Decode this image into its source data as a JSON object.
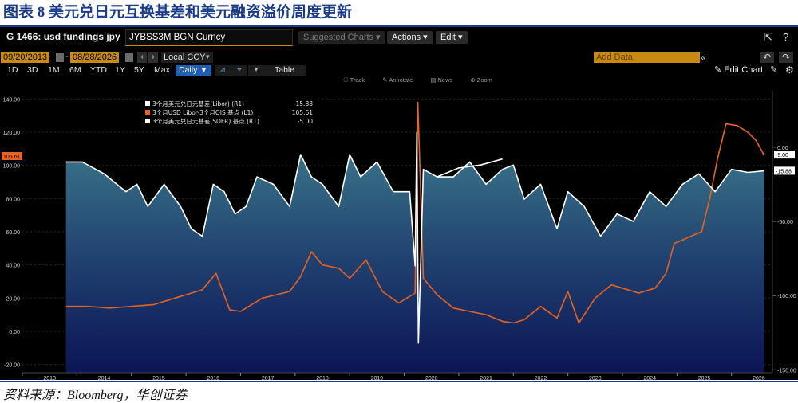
{
  "figure": {
    "title": "图表 8 美元兑日元互换基差和美元融资溢价周度更新",
    "source": "资料来源：Bloomberg，华创证券"
  },
  "header": {
    "security_title": "G 1466: usd fundings jpy",
    "ticker": "JYBSS3M BGN Curncy",
    "suggested_charts": "Suggested Charts",
    "actions": "Actions",
    "edit": "Edit",
    "export_icon": "export-icon",
    "help_icon": "help-icon"
  },
  "controls": {
    "start_date": "09/20/2013",
    "end_date": "08/28/2026",
    "currency": "Local CCY",
    "add_data_placeholder": "Add Data",
    "edit_chart": "Edit Chart",
    "periods": [
      "1D",
      "3D",
      "1M",
      "6M",
      "YTD",
      "1Y",
      "5Y",
      "Max"
    ],
    "frequency": "Daily",
    "table": "Table",
    "tools": [
      "Track",
      "Annotate",
      "News",
      "Zoom"
    ]
  },
  "chart_data": {
    "type": "line",
    "legend": [
      {
        "label": "3个月美元兑日元基差(Libor)  (R1)",
        "value": "-15.88",
        "color": "#ffffff"
      },
      {
        "label": "3个月USD Libor-3个月OIS 基点 (L1)",
        "value": "105.61",
        "color": "#e8621f"
      },
      {
        "label": "3个月美元兑日元基差(SOFR) 基点  (R1)",
        "value": "-5.00",
        "color": "#ffffff"
      }
    ],
    "x_ticks": [
      "2013",
      "2014",
      "2015",
      "2016",
      "2017",
      "2018",
      "2019",
      "2020",
      "2021",
      "2022",
      "2023",
      "2024",
      "2025",
      "2026"
    ],
    "left_axis": {
      "ticks": [
        "140.00",
        "120.00",
        "100.00",
        "80.00",
        "60.00",
        "40.00",
        "20.00",
        "0.00",
        "-20.00"
      ],
      "ylim": [
        -25,
        145
      ]
    },
    "right_axis": {
      "ticks": [
        "0.00",
        "-50.00",
        "-100.00",
        "-150.00"
      ],
      "ylim": [
        -152,
        38
      ]
    },
    "last_values": {
      "left": "105.61",
      "right_a": "-5.00",
      "right_b": "-15.88"
    },
    "series": [
      {
        "name": "3个月USD Libor-3个月OIS 基点 (L1)",
        "axis": "left",
        "color": "#e8621f",
        "x": [
          2013.8,
          2014.2,
          2014.6,
          2015.0,
          2015.4,
          2015.8,
          2016.0,
          2016.3,
          2016.55,
          2016.8,
          2017.0,
          2017.4,
          2017.9,
          2018.1,
          2018.3,
          2018.5,
          2018.8,
          2019.0,
          2019.3,
          2019.6,
          2019.9,
          2020.2,
          2020.25,
          2020.35,
          2020.6,
          2020.9,
          2021.2,
          2021.5,
          2021.8,
          2022.0,
          2022.2,
          2022.5,
          2022.8,
          2023.0,
          2023.2,
          2023.5,
          2023.8,
          2024.0,
          2024.3,
          2024.6,
          2024.8,
          2024.95,
          2025.1,
          2025.3,
          2025.45,
          2025.6,
          2025.75,
          2025.9,
          2026.1,
          2026.3,
          2026.45,
          2026.6
        ],
        "y": [
          15,
          15,
          14,
          15,
          16,
          20,
          22,
          25,
          35,
          13,
          12,
          20,
          24,
          33,
          48,
          40,
          38,
          32,
          43,
          24,
          17,
          23,
          138,
          32,
          22,
          14,
          12,
          10,
          6,
          5,
          7,
          15,
          8,
          24,
          5,
          20,
          28,
          26,
          23,
          26,
          35,
          53,
          55,
          58,
          60,
          80,
          105,
          125,
          124,
          120,
          115,
          106
        ]
      },
      {
        "name": "3个月美元兑日元基差(Libor)  (R1)",
        "axis": "right",
        "color": "#ffffff",
        "x": [
          2013.8,
          2014.1,
          2014.5,
          2014.9,
          2015.1,
          2015.3,
          2015.6,
          2015.9,
          2016.1,
          2016.3,
          2016.5,
          2016.7,
          2016.9,
          2017.1,
          2017.3,
          2017.6,
          2017.9,
          2018.1,
          2018.3,
          2018.5,
          2018.8,
          2019.0,
          2019.2,
          2019.5,
          2019.8,
          2020.1,
          2020.2,
          2020.23,
          2020.26,
          2020.35,
          2020.6,
          2020.9,
          2021.2,
          2021.5,
          2021.8,
          2022.0,
          2022.2,
          2022.5,
          2022.8,
          2023.0,
          2023.3,
          2023.6,
          2023.9,
          2024.2,
          2024.5,
          2024.8,
          2025.1,
          2025.4,
          2025.7,
          2026.0,
          2026.3,
          2026.6
        ],
        "y": [
          -10,
          -10,
          -18,
          -30,
          -25,
          -40,
          -25,
          -40,
          -55,
          -60,
          -25,
          -30,
          -45,
          -40,
          -20,
          -25,
          -40,
          -5,
          -20,
          -25,
          -40,
          -5,
          -20,
          -10,
          -30,
          -30,
          -80,
          10,
          -132,
          -15,
          -20,
          -20,
          -10,
          -25,
          -15,
          -12,
          -35,
          -25,
          -55,
          -30,
          -40,
          -60,
          -45,
          -50,
          -30,
          -40,
          -25,
          -18,
          -30,
          -15,
          -17,
          -16
        ]
      },
      {
        "name": "3个月美元兑日元基差(SOFR) 基点  (R1)",
        "axis": "right",
        "color": "#ffffff",
        "x": [
          2020.6,
          2021.0,
          2021.4,
          2021.8
        ],
        "y": [
          -20,
          -14,
          -12,
          -8
        ]
      }
    ]
  }
}
